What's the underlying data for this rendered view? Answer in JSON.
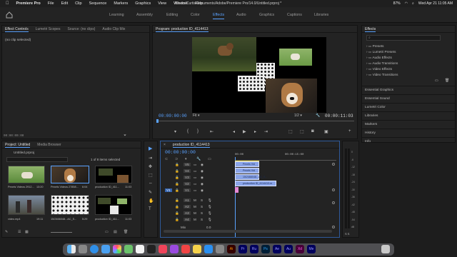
{
  "menubar": {
    "app": "Premiere Pro",
    "menus": [
      "File",
      "Edit",
      "Clip",
      "Sequence",
      "Markers",
      "Graphics",
      "View",
      "Window",
      "Help"
    ],
    "title": "/Users/Curtis/Documents/Adobe/Premiere Pro/14.0/Untitled.prproj *",
    "clock": "Wed Apr 21  11:05 AM",
    "battery": "87%"
  },
  "workspaces": {
    "items": [
      "Learning",
      "Assembly",
      "Editing",
      "Color",
      "Effects",
      "Audio",
      "Graphics",
      "Captions",
      "Libraries"
    ],
    "active": "Effects"
  },
  "source_panel": {
    "tabs": [
      "Effect Controls",
      "Lumetri Scopes",
      "Source: (no clips)",
      "Audio Clip Mix"
    ],
    "no_clip": "(no clip selected)",
    "timecode": "00:00:00:00"
  },
  "program_panel": {
    "tab": "Program: production ID_4114413",
    "timecode": "00:00:00:00",
    "fit": "Fit",
    "resolution": "1/2",
    "duration": "00:00:11:03"
  },
  "effects_panel": {
    "tab": "Effects",
    "folders": [
      "Presets",
      "Lumetri Presets",
      "Audio Effects",
      "Audio Transitions",
      "Video Effects",
      "Video Transitions"
    ],
    "sections": [
      "Essential Graphics",
      "Essential Sound",
      "Lumetri Color",
      "Libraries",
      "Markers",
      "History",
      "Info"
    ]
  },
  "project_panel": {
    "tabs": [
      "Project: Untitled",
      "Media Browser"
    ],
    "file": "Untitled.prproj",
    "selection": "1 of 8 items selected",
    "items": [
      {
        "name": "Pexels Videos 2912...",
        "dur": "13:20"
      },
      {
        "name": "Pexels Videos 27858...",
        "dur": "6:04"
      },
      {
        "name": "production ID_411...",
        "dur": "11:03"
      },
      {
        "name": "video.mp4",
        "dur": "19:11"
      },
      {
        "name": "15/2466048...AC_S...",
        "dur": "5:29"
      },
      {
        "name": "production ID_411...",
        "dur": "11:03"
      }
    ]
  },
  "timeline": {
    "tab": "production ID_4114413",
    "timecode": "00:00:00:00",
    "ruler": [
      "00:00",
      "00:00:15:00"
    ],
    "video_tracks": [
      "V5",
      "V4",
      "V3",
      "V2",
      "V1"
    ],
    "audio_tracks": [
      "A1",
      "A2",
      "A3",
      "A4"
    ],
    "mix": "Mix",
    "mix_value": "0.0",
    "source_patch": "V1",
    "clips": [
      "Pexels Vid",
      "Pexels Vid",
      "15/2466048...AC_S...",
      "production ID_4114413.m"
    ]
  },
  "meter": {
    "scale": [
      "0",
      "-6",
      "-12",
      "-18",
      "-24",
      "-30",
      "-36",
      "-42",
      "-48",
      "-54",
      "dB"
    ],
    "footer": "S S"
  },
  "colors": {
    "accent": "#5aa2ff",
    "clip_video": "#8aa4e8",
    "clip_audio": "#86b586",
    "clip_pink": "#e58ad6"
  },
  "dock_icons": [
    "finder-icon",
    "launchpad-icon",
    "safari-icon",
    "mail-icon",
    "photos-icon",
    "maps-icon",
    "calendar-icon",
    "appletv-icon",
    "music-icon",
    "podcasts-icon",
    "news-icon",
    "notes-icon",
    "appstore-icon",
    "settings-icon",
    "ai-icon",
    "pr-icon",
    "premiere-rush-icon",
    "ps-icon",
    "ae-icon",
    "au-icon",
    "xd-icon",
    "me-icon",
    "trash-icon"
  ]
}
